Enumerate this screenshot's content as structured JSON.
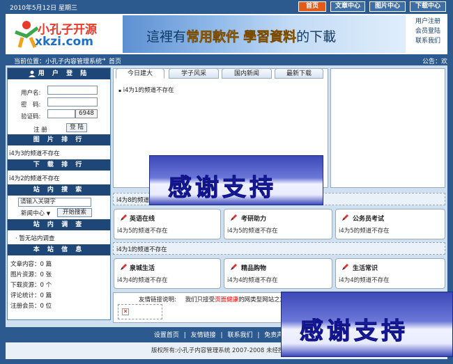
{
  "topbar": {
    "date": "2010年5月12日 星期三",
    "nav": [
      "首页",
      "文章中心",
      "图片中心",
      "下载中心"
    ]
  },
  "header": {
    "logo_cn": "小孔子开源",
    "logo_en": "xkzi.com",
    "banner_pre": "這裡有",
    "banner_hl1": "常用軟件",
    "banner_hl2": "學習資料",
    "banner_post": "的下載",
    "userlinks": [
      "用户注册",
      "会员登陆",
      "联系我们"
    ]
  },
  "location": {
    "label": "当前位置：小孔子内容管理系统",
    "arrow": "→",
    "current": "首页",
    "notice": "公告：欢"
  },
  "sidebar": {
    "login_title": "用 户 登 陆",
    "username_label": "用户名:",
    "password_label": "密　码:",
    "captcha_label": "验证码:",
    "captcha_value": "6948",
    "register_label": "注 册",
    "login_button": "登 陆",
    "img_rank_title": "图 片 排 行",
    "img_rank_msg": "i4为3的频道不存在",
    "dl_rank_title": "下 载 排 行",
    "dl_rank_msg": "i4为2的频道不存在",
    "search_title": "站 内 搜 索",
    "search_placeholder": "请输入关键字",
    "search_scope": "新闻中心",
    "search_button": "开始搜索",
    "survey_title": "站 内 调 查",
    "survey_msg": "· 暂无站内调查",
    "info_title": "本 站 信 息",
    "stats": [
      "文章内容：0 篇",
      "图片资源：0 张",
      "下载资源：0 个",
      "评论统计：0 篇",
      "注册会员：0 位"
    ]
  },
  "main": {
    "tabs": [
      "今日建大",
      "学子风采",
      "国内新闻",
      "最新下载"
    ],
    "tab_content": "i4为1的频道不存在",
    "strip1_text": "i4为8的频道",
    "row1": [
      {
        "title": "英语在线",
        "text": "i4为5的频道不存在"
      },
      {
        "title": "考研助力",
        "text": "i4为5的频道不存在"
      },
      {
        "title": "公务员考试",
        "text": "i4为5的频道不存在"
      }
    ],
    "strip2_text": "i4为1的频道不存在",
    "row2": [
      {
        "title": "泉城生活",
        "text": "i4为4的频道不存在"
      },
      {
        "title": "精品购物",
        "text": "i4为4的频道不存在"
      },
      {
        "title": "生活常识",
        "text": "i4为4的频道不存在"
      }
    ],
    "links_label": "友情链接说明:",
    "links_text_a": "我们只接受",
    "links_text_red": "页面健康",
    "links_text_b": "的网类型网站之友情连接!"
  },
  "overlay": {
    "thanks": "感谢支持"
  },
  "footer": {
    "links": [
      "设置首页",
      "友情链接",
      "联系我们",
      "免责声明"
    ],
    "separator": "|",
    "copyright": "版权所有:小孔子内容管理系统 2007-2008 未经授权禁止"
  },
  "colors": {
    "nav_active": "#e25a17",
    "sidebar_head": "#1e4677",
    "page_bg": "#2c5a8e"
  }
}
